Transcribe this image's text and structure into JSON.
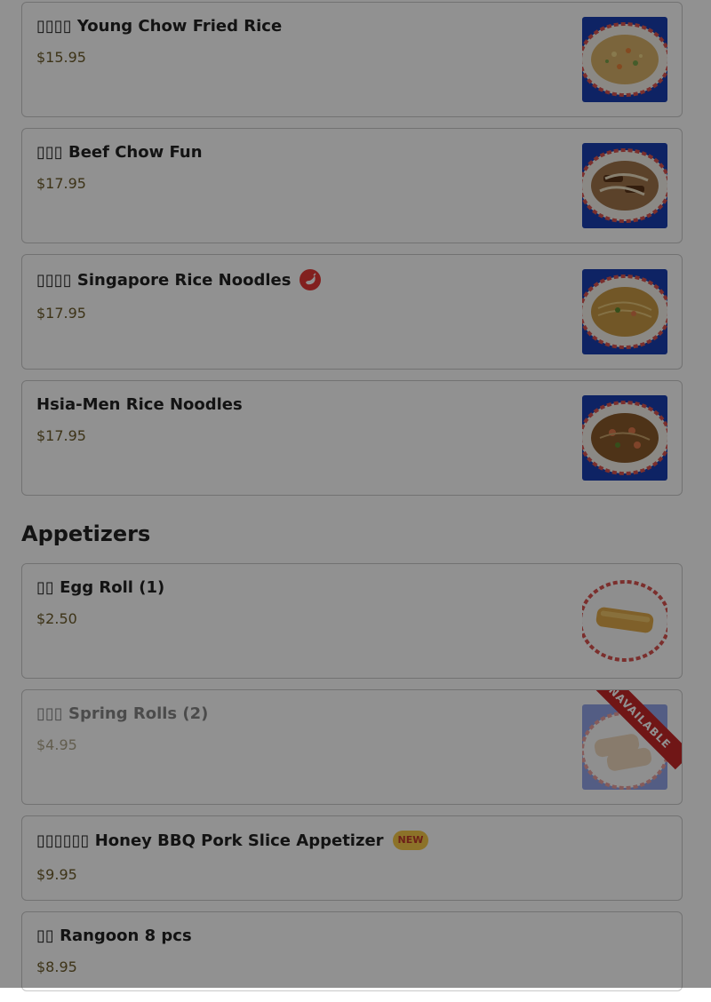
{
  "items_top": [
    {
      "name": "▯▯▯▯ Young Chow Fried Rice",
      "price": "$15.95",
      "image": "fried-rice"
    },
    {
      "name": "▯▯▯ Beef Chow Fun",
      "price": "$17.95",
      "image": "chow-fun"
    },
    {
      "name": "▯▯▯▯ Singapore Rice Noodles",
      "price": "$17.95",
      "image": "rice-noodles",
      "badge_icon": "chili-icon"
    },
    {
      "name": "Hsia-Men Rice Noodles",
      "price": "$17.95",
      "image": "hsia-men"
    }
  ],
  "section": {
    "title": "Appetizers"
  },
  "items_appetizers": [
    {
      "name": "▯▯ Egg Roll (1)",
      "price": "$2.50",
      "image": "egg-roll"
    },
    {
      "name": "▯▯▯ Spring Rolls (2)",
      "price": "$4.95",
      "image": "spring-rolls",
      "ribbon": "UNAVAILABLE"
    },
    {
      "name": "▯▯▯▯▯▯ Honey BBQ Pork Slice Appetizer",
      "price": "$9.95",
      "badge": "NEW"
    },
    {
      "name": "▯▯ Rangoon 8 pcs",
      "price": "$8.95"
    }
  ],
  "colors": {
    "overlay": "rgba(0,0,0,0.43)",
    "price": "#6b5b2a",
    "chili_badge": "#e53935",
    "new_badge": "#f7c948",
    "ribbon": "#c62828"
  }
}
